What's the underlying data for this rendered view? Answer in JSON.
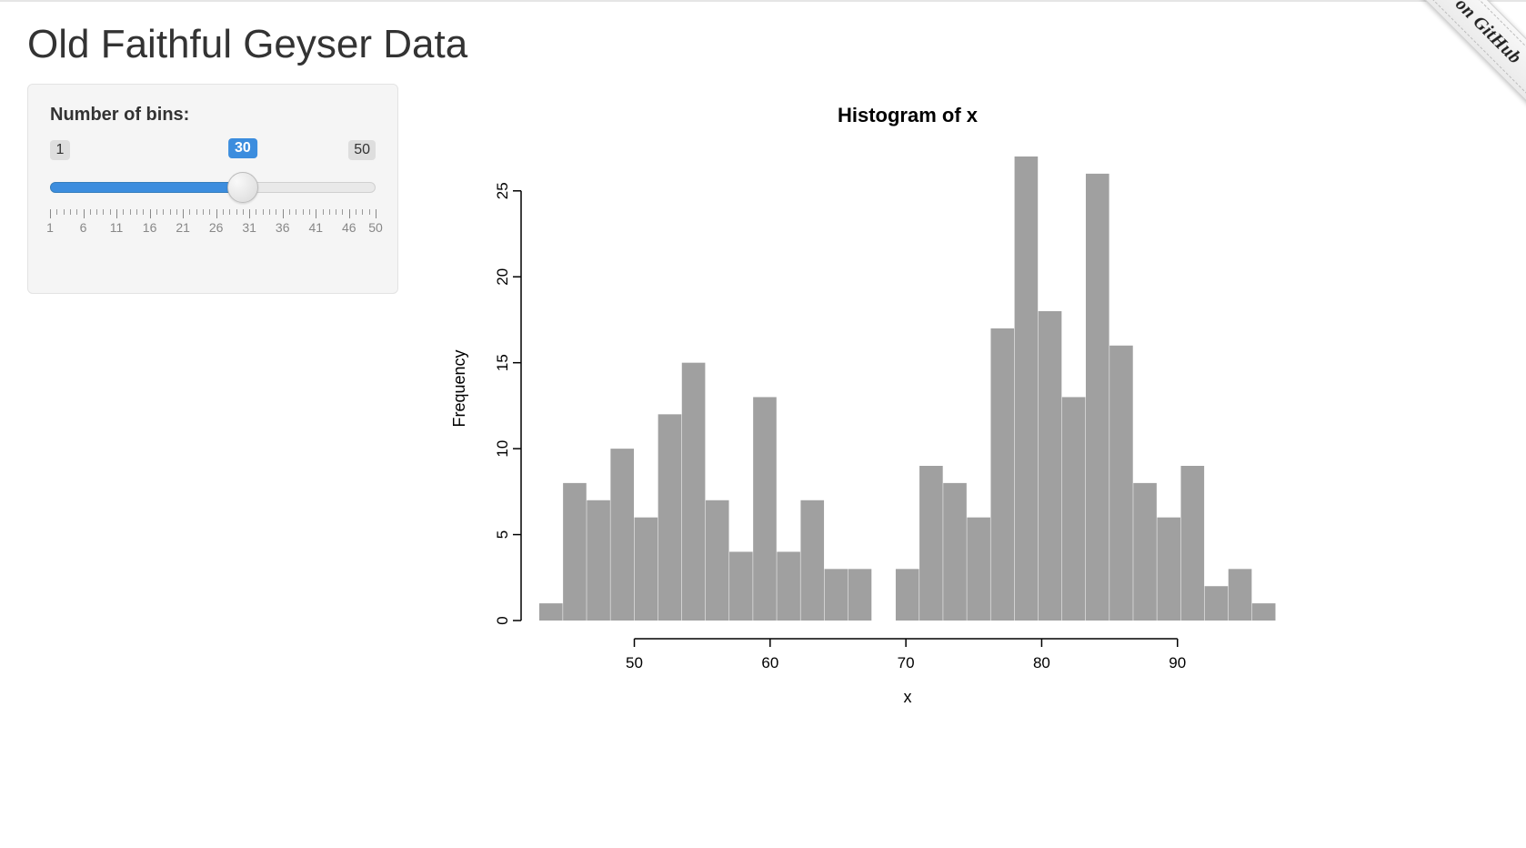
{
  "page": {
    "title": "Old Faithful Geyser Data"
  },
  "ribbon": {
    "label": "Fork me on GitHub"
  },
  "slider": {
    "label": "Number of bins:",
    "min": 1,
    "max": 50,
    "value": 30,
    "min_label": "1",
    "max_label": "50",
    "value_label": "30",
    "tick_labels": [
      "1",
      "6",
      "11",
      "16",
      "21",
      "26",
      "31",
      "36",
      "41",
      "46",
      "50"
    ]
  },
  "chart_data": {
    "type": "bar",
    "title": "Histogram of x",
    "xlabel": "x",
    "ylabel": "Frequency",
    "ylim": [
      0,
      27
    ],
    "x_ticks": [
      50,
      60,
      70,
      80,
      90
    ],
    "y_ticks": [
      0,
      5,
      10,
      15,
      20,
      25
    ],
    "bin_start": 43,
    "bin_width": 1.75,
    "values": [
      1,
      8,
      7,
      10,
      6,
      12,
      15,
      7,
      4,
      13,
      4,
      7,
      3,
      3,
      0,
      3,
      9,
      8,
      6,
      17,
      27,
      18,
      13,
      26,
      16,
      8,
      6,
      9,
      2,
      3,
      1
    ]
  }
}
